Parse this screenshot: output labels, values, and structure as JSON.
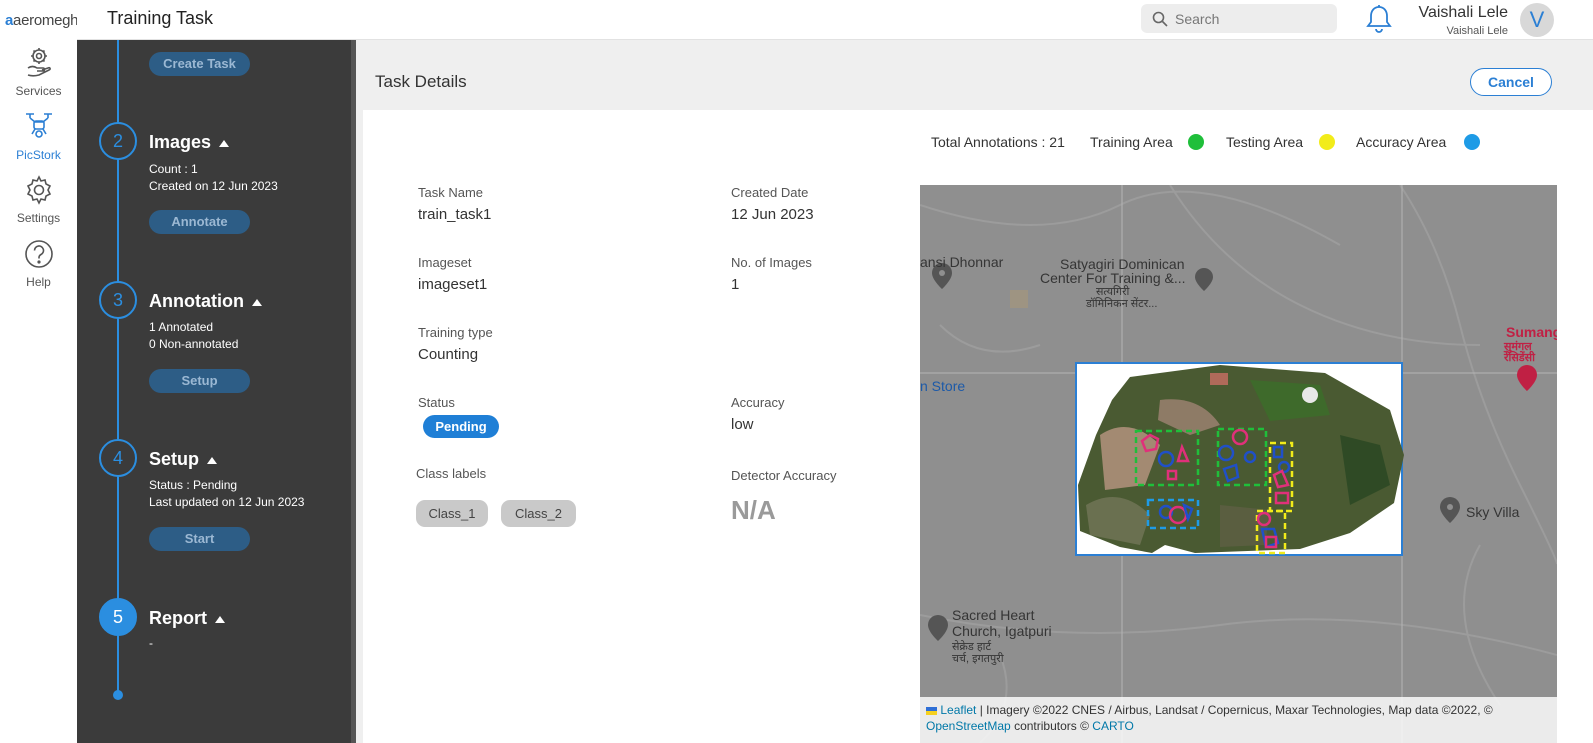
{
  "app": {
    "logo_text": "aeromegh",
    "title": "Training Task"
  },
  "rail": {
    "items": [
      {
        "label": "Services",
        "icon": "services-icon",
        "active": false
      },
      {
        "label": "PicStork",
        "icon": "drone-icon",
        "active": true
      },
      {
        "label": "Settings",
        "icon": "gear-icon",
        "active": false
      },
      {
        "label": "Help",
        "icon": "help-icon",
        "active": false
      }
    ]
  },
  "topbar": {
    "search_placeholder": "Search",
    "user_name": "Vaishali Lele",
    "user_sub": "Vaishali Lele",
    "avatar_letter": "V"
  },
  "steps": {
    "create_button": "Create Task",
    "items": [
      {
        "number": "2",
        "title": "Images",
        "lines": [
          "Count : 1",
          "Created on 12 Jun 2023"
        ],
        "button": "Annotate"
      },
      {
        "number": "3",
        "title": "Annotation",
        "lines": [
          "1 Annotated",
          "0 Non-annotated"
        ],
        "button": "Setup"
      },
      {
        "number": "4",
        "title": "Setup",
        "lines": [
          "Status : Pending",
          "Last updated on 12 Jun 2023"
        ],
        "button": "Start"
      },
      {
        "number": "5",
        "title": "Report",
        "lines": [
          "-"
        ],
        "button": ""
      }
    ]
  },
  "main": {
    "page_title": "Task Details",
    "cancel_label": "Cancel"
  },
  "legend": {
    "total": "Total Annotations : 21",
    "training": "Training Area",
    "testing": "Testing Area",
    "accuracy": "Accuracy Area",
    "colors": {
      "training": "#1fbf3a",
      "testing": "#f2ec1a",
      "accuracy": "#1e9be6"
    }
  },
  "details": {
    "task_name_label": "Task Name",
    "task_name": "train_task1",
    "created_date_label": "Created Date",
    "created_date": "12 Jun 2023",
    "imageset_label": "Imageset",
    "imageset": "imageset1",
    "num_images_label": "No. of Images",
    "num_images": "1",
    "training_type_label": "Training type",
    "training_type": "Counting",
    "status_label": "Status",
    "status": "Pending",
    "accuracy_label": "Accuracy",
    "accuracy": "low",
    "class_labels_label": "Class labels",
    "class_labels": [
      "Class_1",
      "Class_2"
    ],
    "detector_accuracy_label": "Detector Accuracy",
    "detector_accuracy": "N/A"
  },
  "map": {
    "labels": {
      "place1": "ansi Dhonnar",
      "place2_line1": "Satyagiri Dominican",
      "place2_line2": "Center For Training &...",
      "place2_line3": "सत्यगिरी",
      "place2_line4": "डॉमिनिकन सेंटर...",
      "store": "n Store",
      "sumang_line1": "Sumang",
      "sumang_line2": "सुमंगल",
      "sumang_line3": "रेसिडेंसी",
      "skyvilla": "Sky Villa",
      "church_line1": "Sacred Heart",
      "church_line2": "Church, Igatpuri",
      "church_line3": "सेक्रेड हार्ट",
      "church_line4": "चर्च, इगतपुरी"
    },
    "attribution": {
      "leaflet": "Leaflet",
      "text1": "| Imagery ©2022 CNES / Airbus, Landsat / Copernicus, Maxar Technologies, Map data ©2022, ©",
      "osm": "OpenStreetMap",
      "text2": "contributors ©",
      "carto": "CARTO"
    }
  }
}
